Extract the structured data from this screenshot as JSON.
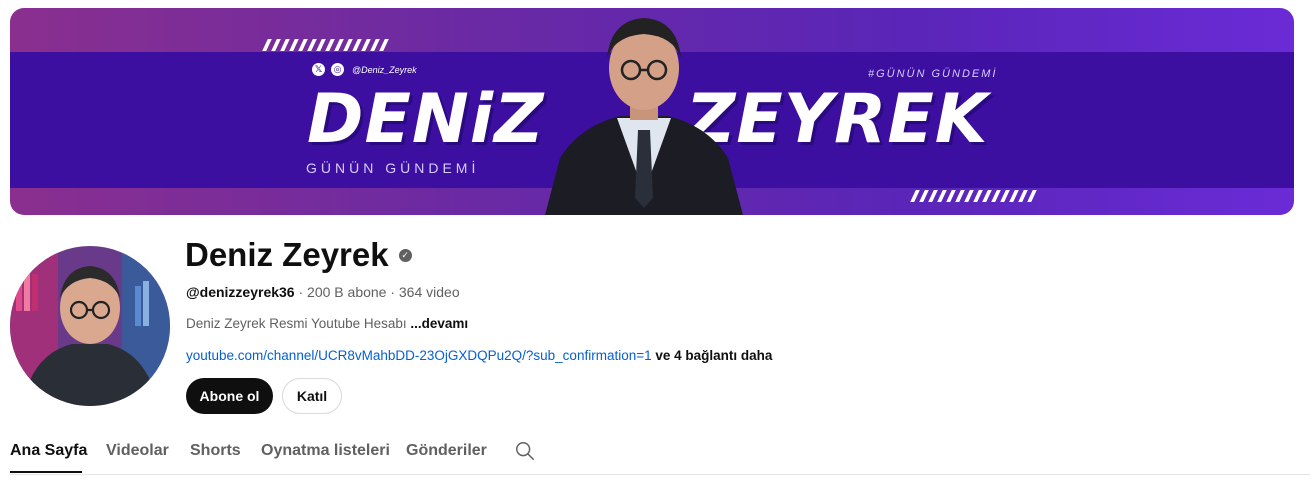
{
  "banner": {
    "first_name": "DENiZ",
    "last_name": "ZEYREK",
    "subtitle": "GÜNÜN GÜNDEMİ",
    "hashtag": "#GÜNÜN GÜNDEMİ",
    "social_handle": "@Deniz_Zeyrek",
    "social_icons": [
      "x-icon",
      "instagram-icon"
    ],
    "colors": {
      "primary": "#3d0fa0",
      "accent": "#8a2f8f"
    }
  },
  "channel": {
    "name": "Deniz Zeyrek",
    "handle": "@denizzeyrek36",
    "stats": " · 200 B abone · 364 video",
    "description": "Deniz Zeyrek Resmi Youtube Hesabı ",
    "description_more": "...devamı",
    "link_url": "youtube.com/channel/UCR8vMahbDD-23OjGXDQPu2Q/?sub_confirmation=1",
    "link_more": " ve 4 bağlantı daha"
  },
  "buttons": {
    "subscribe": "Abone ol",
    "join": "Katıl"
  },
  "tabs": [
    {
      "label": "Ana Sayfa",
      "active": true
    },
    {
      "label": "Videolar",
      "active": false
    },
    {
      "label": "Shorts",
      "active": false
    },
    {
      "label": "Oynatma listeleri",
      "active": false
    },
    {
      "label": "Gönderiler",
      "active": false
    }
  ]
}
